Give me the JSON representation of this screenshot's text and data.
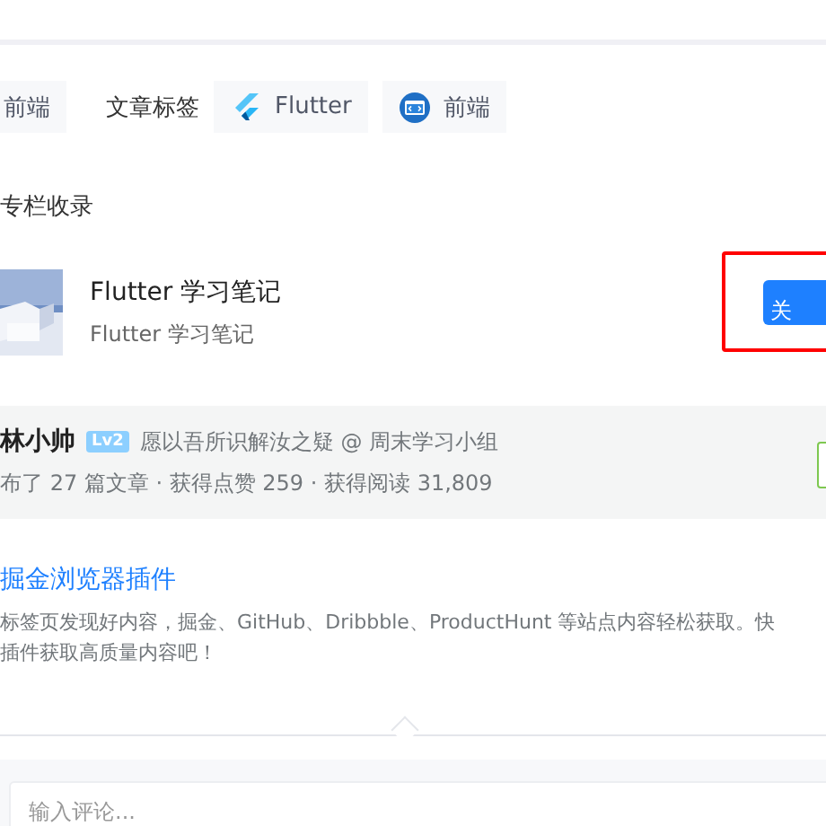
{
  "tags_row": {
    "category_tag": "前端",
    "label": "文章标签",
    "tags": [
      {
        "kind": "flutter",
        "label": "Flutter"
      },
      {
        "kind": "frontend",
        "label": "前端"
      }
    ]
  },
  "column_section": {
    "heading": "专栏收录",
    "column": {
      "kind": "picture",
      "title": "Flutter 学习笔记",
      "subtitle": "Flutter 学习笔记",
      "follow_button": "关",
      "highlighted": true
    }
  },
  "author": {
    "name": "林小帅",
    "level": "Lv2",
    "bio": "愿以吾所识解汝之疑 @ 周末学习小组",
    "stats": "布了 27 篇文章 · 获得点赞 259 · 获得阅读 31,809"
  },
  "plugin": {
    "title": "掘金浏览器插件",
    "description_lines": [
      "标签页发现好内容，掘金、GitHub、Dribbble、ProductHunt 等站点内容轻松获取。快",
      "插件获取高质量内容吧！"
    ]
  },
  "comment": {
    "placeholder": "输入评论..."
  }
}
